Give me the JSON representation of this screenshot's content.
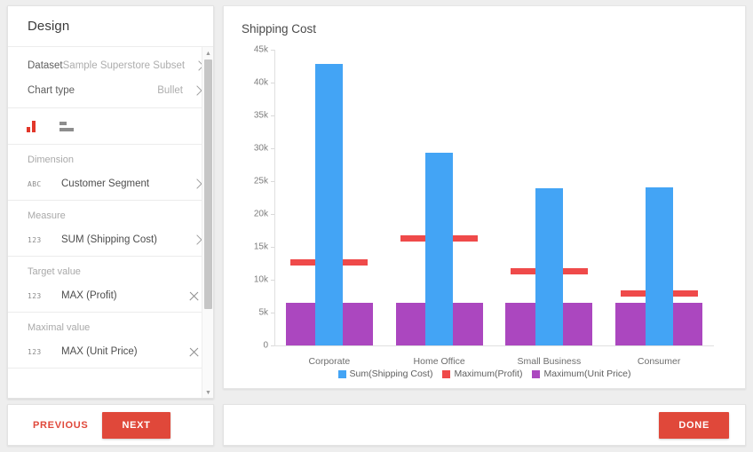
{
  "sidebar": {
    "title": "Design",
    "dataset": {
      "label": "Dataset",
      "value": "Sample Superstore Subset"
    },
    "chart_type": {
      "label": "Chart type",
      "value": "Bullet"
    },
    "orientation_icons": [
      {
        "name": "vertical-bars-icon",
        "active": true
      },
      {
        "name": "horizontal-bars-icon",
        "active": false
      }
    ],
    "groups": [
      {
        "label": "Dimension",
        "type_icon": "ABC",
        "field": "Customer Segment",
        "action": "chevron"
      },
      {
        "label": "Measure",
        "type_icon": "123",
        "field": "SUM (Shipping Cost)",
        "action": "chevron"
      },
      {
        "label": "Target value",
        "type_icon": "123",
        "field": "MAX (Profit)",
        "action": "clear"
      },
      {
        "label": "Maximal value",
        "type_icon": "123",
        "field": "MAX (Unit Price)",
        "action": "clear"
      }
    ]
  },
  "footer": {
    "previous_label": "PREVIOUS",
    "next_label": "NEXT",
    "done_label": "DONE"
  },
  "colors": {
    "measure": "#43a4f5",
    "target": "#ef4a4a",
    "maximum": "#ab47bf",
    "accent": "#e0483a"
  },
  "chart_data": {
    "type": "bar",
    "title": "Shipping Cost",
    "xlabel": "",
    "ylabel": "",
    "ylim": [
      0,
      45000
    ],
    "yticks": [
      0,
      5000,
      10000,
      15000,
      20000,
      25000,
      30000,
      35000,
      40000,
      45000
    ],
    "ytick_labels": [
      "0",
      "5k",
      "10k",
      "15k",
      "20k",
      "25k",
      "30k",
      "35k",
      "40k",
      "45k"
    ],
    "grid": false,
    "legend_position": "bottom",
    "categories": [
      "Corporate",
      "Home Office",
      "Small Business",
      "Consumer"
    ],
    "series": [
      {
        "name": "Sum(Shipping Cost)",
        "kind": "measure",
        "color": "#43a4f5",
        "values": [
          42840,
          29320,
          23900,
          24050
        ]
      },
      {
        "name": "Maximum(Profit)",
        "kind": "target",
        "color": "#ef4a4a",
        "values": [
          12570,
          16220,
          11220,
          7970
        ]
      },
      {
        "name": "Maximum(Unit Price)",
        "kind": "range",
        "color": "#ab47bf",
        "values": [
          6490,
          6490,
          6490,
          6490
        ]
      }
    ]
  }
}
